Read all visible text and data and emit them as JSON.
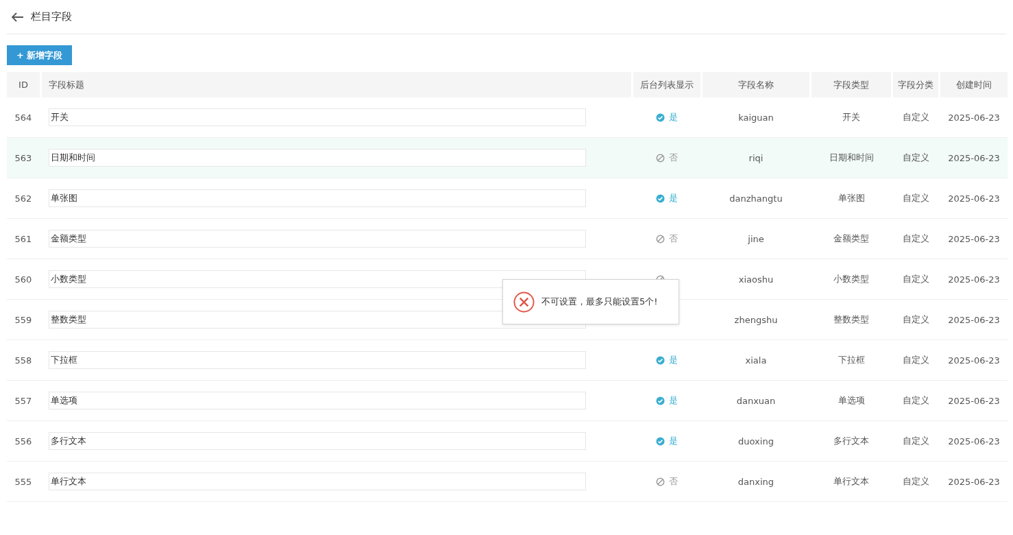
{
  "page": {
    "title": "栏目字段"
  },
  "add_button": {
    "label": "+ 新增字段"
  },
  "table": {
    "columns": [
      "ID",
      "字段标题",
      "后台列表显示",
      "字段名称",
      "字段类型",
      "字段分类",
      "创建时间"
    ],
    "rows": [
      {
        "id": "564",
        "title": "开关",
        "show": true,
        "show_label": "是",
        "name": "kaiguan",
        "type": "开关",
        "category": "自定义",
        "created": "2025-06-23",
        "highlighted": false
      },
      {
        "id": "563",
        "title": "日期和时间",
        "show": false,
        "show_label": "否",
        "name": "riqi",
        "type": "日期和时间",
        "category": "自定义",
        "created": "2025-06-23",
        "highlighted": true
      },
      {
        "id": "562",
        "title": "单张图",
        "show": true,
        "show_label": "是",
        "name": "danzhangtu",
        "type": "单张图",
        "category": "自定义",
        "created": "2025-06-23",
        "highlighted": false
      },
      {
        "id": "561",
        "title": "金额类型",
        "show": false,
        "show_label": "否",
        "name": "jine",
        "type": "金额类型",
        "category": "自定义",
        "created": "2025-06-23",
        "highlighted": false
      },
      {
        "id": "560",
        "title": "小数类型",
        "show": false,
        "name": "xiaoshu",
        "type": "小数类型",
        "category": "自定义",
        "created": "2025-06-23",
        "highlighted": false
      },
      {
        "id": "559",
        "title": "整数类型",
        "name": "zhengshu",
        "type": "整数类型",
        "category": "自定义",
        "created": "2025-06-23",
        "highlighted": false
      },
      {
        "id": "558",
        "title": "下拉框",
        "show": true,
        "show_label": "是",
        "name": "xiala",
        "type": "下拉框",
        "category": "自定义",
        "created": "2025-06-23",
        "highlighted": false
      },
      {
        "id": "557",
        "title": "单选项",
        "show": true,
        "show_label": "是",
        "name": "danxuan",
        "type": "单选项",
        "category": "自定义",
        "created": "2025-06-23",
        "highlighted": false
      },
      {
        "id": "556",
        "title": "多行文本",
        "show": true,
        "show_label": "是",
        "name": "duoxing",
        "type": "多行文本",
        "category": "自定义",
        "created": "2025-06-23",
        "highlighted": false
      },
      {
        "id": "555",
        "title": "单行文本",
        "show": false,
        "show_label": "否",
        "name": "danxing",
        "type": "单行文本",
        "category": "自定义",
        "created": "2025-06-23",
        "highlighted": false
      }
    ]
  },
  "toast": {
    "message": "不可设置，最多只能设置5个!"
  }
}
